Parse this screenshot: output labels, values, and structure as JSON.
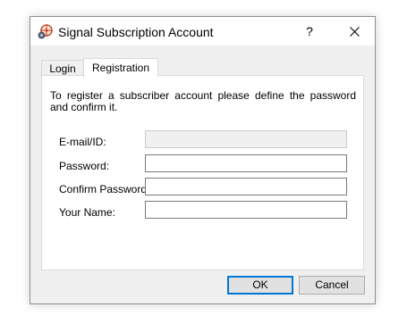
{
  "window": {
    "title": "Signal Subscription Account",
    "help_label": "?",
    "close_label": "✕"
  },
  "tabs": [
    {
      "label": "Login",
      "selected": false
    },
    {
      "label": "Registration",
      "selected": true
    }
  ],
  "registration": {
    "instruction": "To register a subscriber account please define the password and confirm it.",
    "fields": [
      {
        "label": "E-mail/ID:",
        "value": "",
        "enabled": false
      },
      {
        "label": "Password:",
        "value": "",
        "enabled": true
      },
      {
        "label": "Confirm Password:",
        "value": "",
        "enabled": true
      },
      {
        "label": "Your Name:",
        "value": "",
        "enabled": true
      }
    ]
  },
  "buttons": {
    "ok_label": "OK",
    "cancel_label": "Cancel"
  },
  "colors": {
    "dialog_background": "#f0f0f0",
    "default_button_border": "#0078d7"
  },
  "icons": {
    "app": "signal-crosshair-icon",
    "close": "close-icon",
    "help": "help-icon"
  }
}
